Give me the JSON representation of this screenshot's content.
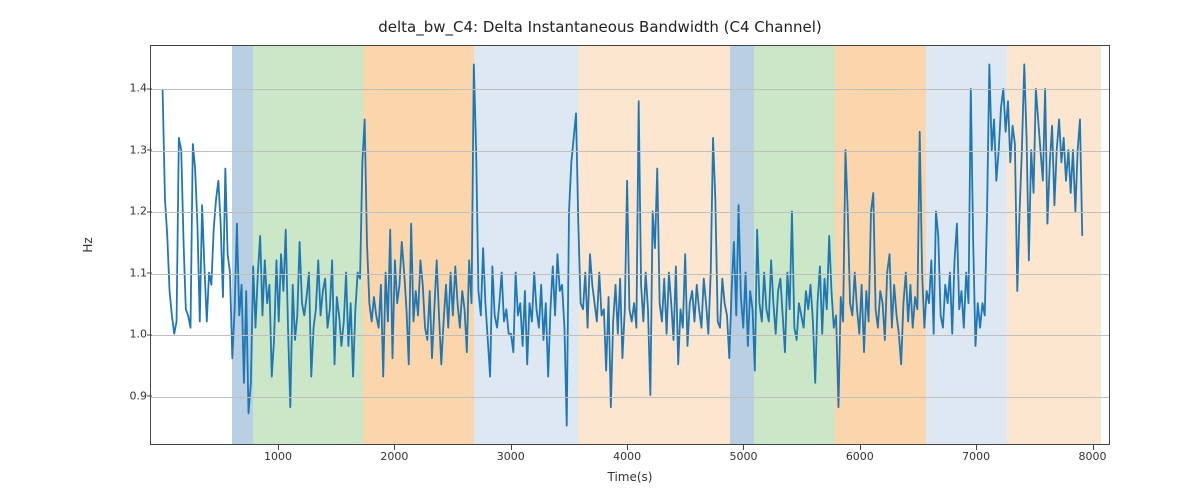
{
  "chart_data": {
    "type": "line",
    "title": "delta_bw_C4: Delta Instantaneous Bandwidth (C4 Channel)",
    "xlabel": "Time(s)",
    "ylabel": "Hz",
    "xlim": [
      -100,
      8150
    ],
    "ylim": [
      0.82,
      1.47
    ],
    "xticks": [
      1000,
      2000,
      3000,
      4000,
      5000,
      6000,
      7000,
      8000
    ],
    "yticks": [
      0.9,
      1.0,
      1.1,
      1.2,
      1.3,
      1.4
    ],
    "grid": true,
    "bands": [
      {
        "x0": 600,
        "x1": 780,
        "color": "#b8cfe4"
      },
      {
        "x0": 780,
        "x1": 1720,
        "color": "#cbe7c8"
      },
      {
        "x0": 1720,
        "x1": 2680,
        "color": "#fbd6ad"
      },
      {
        "x0": 2680,
        "x1": 3580,
        "color": "#dde8f2"
      },
      {
        "x0": 3580,
        "x1": 4880,
        "color": "#fce6cf"
      },
      {
        "x0": 4880,
        "x1": 5080,
        "color": "#b8cfe4"
      },
      {
        "x0": 5080,
        "x1": 5780,
        "color": "#cbe7c8"
      },
      {
        "x0": 5780,
        "x1": 6560,
        "color": "#fbd6ad"
      },
      {
        "x0": 6560,
        "x1": 7260,
        "color": "#dde8f2"
      },
      {
        "x0": 7260,
        "x1": 8060,
        "color": "#fce6cf"
      }
    ],
    "line_color": "#1f77b4",
    "series": [
      {
        "name": "delta_bw_C4",
        "x_step": 20,
        "y": [
          1.4,
          1.22,
          1.16,
          1.07,
          1.03,
          1.0,
          1.02,
          1.32,
          1.3,
          1.15,
          1.04,
          1.03,
          1.01,
          1.31,
          1.27,
          1.18,
          1.02,
          1.21,
          1.11,
          1.02,
          1.1,
          1.08,
          1.17,
          1.22,
          1.25,
          1.18,
          1.06,
          1.27,
          1.13,
          1.1,
          0.96,
          1.04,
          1.18,
          1.03,
          1.08,
          0.92,
          1.07,
          0.87,
          0.92,
          1.11,
          1.01,
          1.1,
          1.16,
          1.03,
          1.12,
          1.05,
          1.08,
          0.93,
          0.99,
          1.12,
          1.02,
          1.13,
          1.07,
          1.17,
          1.01,
          0.88,
          1.08,
          0.99,
          1.03,
          1.15,
          1.05,
          1.03,
          1.06,
          1.1,
          0.93,
          1.01,
          1.04,
          1.12,
          1.03,
          1.07,
          1.09,
          1.01,
          1.04,
          1.12,
          0.95,
          1.06,
          1.03,
          0.98,
          1.02,
          1.1,
          0.98,
          1.05,
          0.93,
          1.04,
          1.1,
          1.09,
          1.28,
          1.35,
          1.15,
          1.05,
          1.02,
          1.06,
          1.03,
          1.01,
          1.08,
          0.93,
          1.1,
          1.02,
          1.17,
          0.96,
          1.12,
          1.05,
          1.08,
          1.15,
          1.1,
          1.04,
          0.95,
          1.18,
          1.02,
          1.07,
          1.03,
          1.12,
          1.08,
          1.01,
          0.99,
          1.07,
          0.96,
          1.04,
          1.12,
          1.03,
          0.95,
          1.02,
          1.08,
          1.01,
          1.1,
          1.03,
          1.11,
          1.05,
          1.01,
          1.07,
          1.04,
          0.97,
          1.12,
          1.05,
          1.44,
          1.3,
          1.07,
          1.03,
          1.14,
          1.05,
          0.99,
          0.93,
          1.11,
          1.03,
          1.01,
          1.05,
          1.1,
          1.02,
          1.04,
          1.0,
          1.0,
          0.97,
          1.1,
          1.03,
          1.05,
          0.98,
          1.07,
          0.95,
          1.05,
          1.02,
          1.1,
          1.04,
          1.01,
          1.08,
          0.99,
          1.05,
          0.93,
          1.04,
          1.11,
          1.03,
          1.13,
          1.07,
          1.08,
          1.01,
          0.85,
          1.2,
          1.28,
          1.32,
          1.36,
          1.18,
          1.05,
          1.04,
          1.1,
          1.01,
          1.13,
          1.08,
          1.05,
          1.02,
          1.1,
          1.03,
          1.04,
          0.94,
          1.06,
          0.88,
          1.02,
          1.08,
          1.0,
          1.09,
          0.96,
          1.04,
          1.25,
          1.04,
          1.02,
          1.05,
          1.01,
          1.38,
          1.08,
          1.02,
          1.1,
          1.04,
          0.9,
          1.2,
          1.14,
          1.27,
          1.05,
          1.02,
          1.09,
          1.0,
          1.1,
          1.05,
          0.99,
          1.11,
          0.95,
          1.04,
          1.01,
          1.13,
          0.98,
          1.05,
          1.07,
          1.02,
          1.08,
          1.04,
          1.01,
          1.09,
          1.05,
          1.0,
          1.1,
          1.32,
          1.22,
          1.02,
          1.01,
          1.09,
          1.05,
          1.03,
          0.96,
          1.07,
          1.15,
          1.03,
          1.21,
          1.06,
          1.01,
          1.1,
          0.98,
          1.07,
          1.04,
          0.94,
          1.17,
          1.05,
          1.02,
          1.1,
          1.04,
          1.02,
          1.12,
          1.05,
          1.0,
          1.07,
          1.09,
          1.03,
          0.97,
          1.1,
          1.04,
          1.2,
          1.01,
          0.99,
          1.05,
          1.03,
          1.01,
          1.07,
          1.04,
          1.08,
          1.02,
          0.92,
          1.05,
          1.11,
          1.0,
          1.09,
          1.04,
          1.16,
          1.07,
          1.01,
          1.03,
          0.88,
          1.06,
          1.02,
          1.3,
          1.2,
          1.05,
          1.03,
          1.1,
          1.04,
          1.0,
          1.08,
          0.97,
          1.07,
          1.02,
          1.2,
          1.23,
          1.04,
          1.01,
          1.07,
          1.05,
          0.99,
          1.1,
          1.13,
          1.01,
          1.08,
          1.03,
          1.0,
          0.95,
          1.05,
          1.1,
          1.02,
          1.08,
          1.01,
          1.06,
          1.04,
          1.33,
          1.1,
          1.01,
          1.07,
          1.05,
          1.12,
          1.0,
          1.2,
          1.16,
          1.03,
          1.01,
          1.08,
          1.05,
          1.1,
          1.0,
          1.12,
          1.18,
          1.04,
          1.07,
          1.01,
          1.1,
          1.05,
          1.4,
          1.15,
          0.98,
          1.05,
          1.01,
          1.05,
          1.03,
          1.2,
          1.44,
          1.3,
          1.35,
          1.25,
          1.3,
          1.37,
          1.4,
          1.33,
          1.38,
          1.28,
          1.34,
          1.31,
          1.07,
          1.2,
          1.3,
          1.44,
          1.32,
          1.12,
          1.3,
          1.23,
          1.4,
          1.35,
          1.3,
          1.25,
          1.4,
          1.18,
          1.28,
          1.34,
          1.21,
          1.3,
          1.35,
          1.28,
          1.32,
          1.25,
          1.3,
          1.23,
          1.3,
          1.2,
          1.3,
          1.35,
          1.16
        ]
      }
    ]
  }
}
